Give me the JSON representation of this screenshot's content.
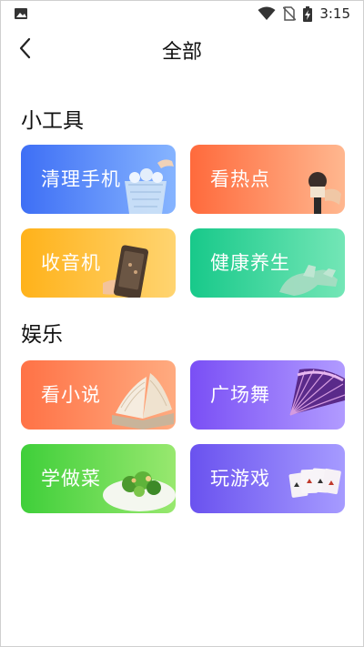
{
  "status": {
    "time": "3:15"
  },
  "header": {
    "title": "全部"
  },
  "sections": [
    {
      "title": "小工具",
      "items": [
        {
          "label": "清理手机",
          "icon": "trash-can-icon"
        },
        {
          "label": "看热点",
          "icon": "microphone-icon"
        },
        {
          "label": "收音机",
          "icon": "phone-radio-icon"
        },
        {
          "label": "健康养生",
          "icon": "hand-icon"
        }
      ]
    },
    {
      "title": "娱乐",
      "items": [
        {
          "label": "看小说",
          "icon": "book-icon"
        },
        {
          "label": "广场舞",
          "icon": "fan-icon"
        },
        {
          "label": "学做菜",
          "icon": "salad-icon"
        },
        {
          "label": "玩游戏",
          "icon": "playing-cards-icon"
        }
      ]
    }
  ],
  "colors": {
    "clean": [
      "#3e6ff5",
      "#86b4ff"
    ],
    "hot": [
      "#ff6a3c",
      "#ffb78f"
    ],
    "radio": [
      "#ffb21a",
      "#ffd470"
    ],
    "health": [
      "#18c98a",
      "#73e6b6"
    ],
    "novel": [
      "#ff7246",
      "#ffab80"
    ],
    "dance": [
      "#7a4ff5",
      "#b19bff"
    ],
    "cook": [
      "#3fcf3a",
      "#98e86f"
    ],
    "game": [
      "#6a52ef",
      "#a69bff"
    ]
  }
}
